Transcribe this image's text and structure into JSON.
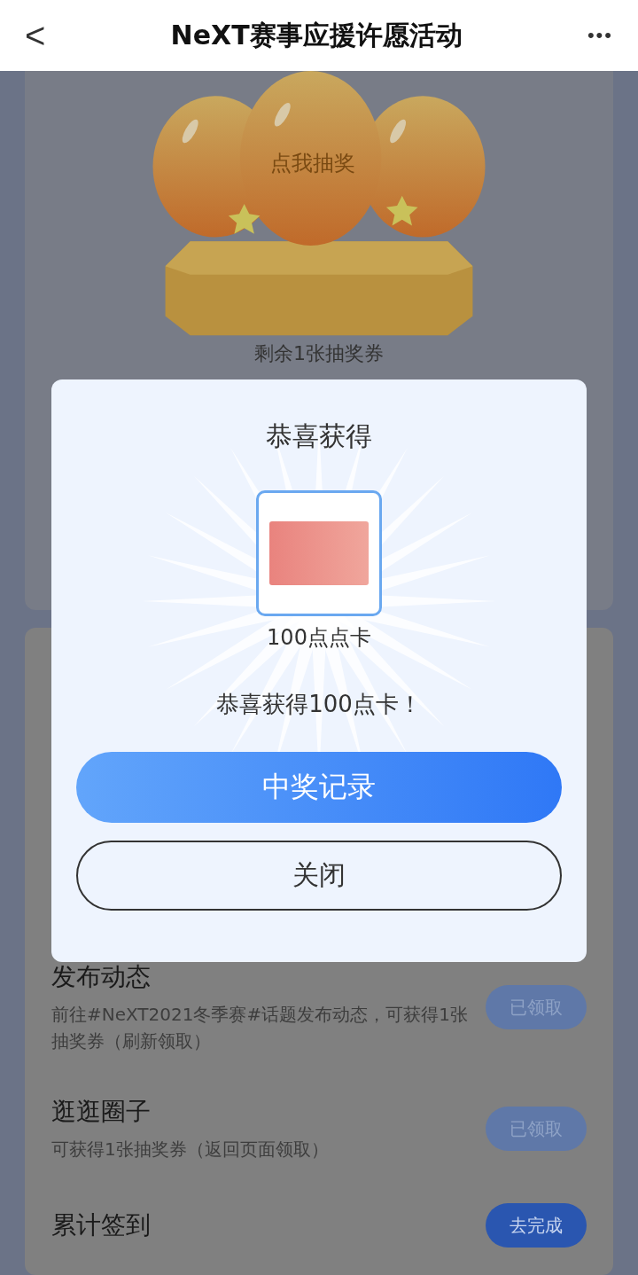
{
  "header": {
    "back": "<",
    "title": "NeXT赛事应援许愿活动",
    "more": "•••"
  },
  "lottery": {
    "egg_label": "点我抽奖",
    "remaining": "剩余1张抽奖券"
  },
  "tasks": [
    {
      "title": "发布动态",
      "description": "前往#NeXT2021冬季赛#话题发布动态，可获得1张抽奖券（刷新领取）",
      "button": "已领取",
      "claimed": true
    },
    {
      "title": "逛逛圈子",
      "description": "可获得1张抽奖券（返回页面领取）",
      "button": "已领取",
      "claimed": true
    },
    {
      "title": "累计签到",
      "button": "去完成",
      "claimed": false
    }
  ],
  "dialog": {
    "title": "恭喜获得",
    "prize_name": "100点点卡",
    "message": "恭喜获得100点卡！",
    "primary_button": "中奖记录",
    "close_button": "关闭"
  }
}
